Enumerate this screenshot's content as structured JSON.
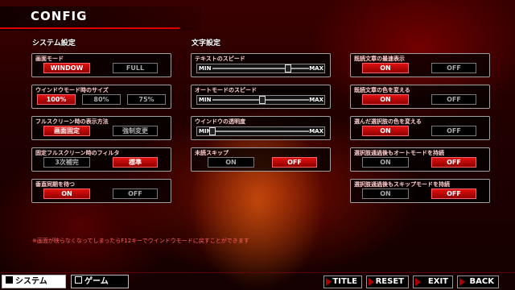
{
  "header": {
    "title": "CONFIG"
  },
  "sections": {
    "system": "システム設定",
    "text": "文字設定"
  },
  "system": {
    "screen_mode": {
      "label": "画面モード",
      "options": [
        "WINDOW",
        "FULL"
      ],
      "selected": "WINDOW"
    },
    "window_size": {
      "label": "ウインドウモード時のサイズ",
      "options": [
        "100%",
        "80%",
        "75%"
      ],
      "selected": "100%"
    },
    "fullscreen_display": {
      "label": "フルスクリーン時の表示方法",
      "options": [
        "画面固定",
        "強制変更"
      ],
      "selected": "画面固定"
    },
    "fixed_fullscreen_filter": {
      "label": "固定フルスクリーン時のフィルタ",
      "options": [
        "3次補完",
        "標準"
      ],
      "selected": "標準"
    },
    "vsync": {
      "label": "垂直同期を待つ",
      "options": [
        "ON",
        "OFF"
      ],
      "selected": "ON"
    }
  },
  "text": {
    "text_speed": {
      "label": "テキストのスピード",
      "min": "MIN",
      "max": "MAX",
      "level": 0.78
    },
    "auto_speed": {
      "label": "オートモードのスピード",
      "min": "MIN",
      "max": "MAX",
      "level": 0.52
    },
    "window_opacity": {
      "label": "ウインドウの透明度",
      "min": "MIN",
      "max": "MAX",
      "level": 0.0
    },
    "skip_unread": {
      "label": "未読スキップ",
      "options": [
        "ON",
        "OFF"
      ],
      "selected": "OFF"
    }
  },
  "read": {
    "fastest_read_text": {
      "label": "既読文章の最速表示",
      "options": [
        "ON",
        "OFF"
      ],
      "selected": "ON"
    },
    "read_text_color": {
      "label": "既読文章の色を変える",
      "options": [
        "ON",
        "OFF"
      ],
      "selected": "ON"
    },
    "chosen_choice_color": {
      "label": "選んだ選択肢の色を変える",
      "options": [
        "ON",
        "OFF"
      ],
      "selected": "ON"
    },
    "keep_auto_after_choice": {
      "label": "選択肢通過後もオートモードを持続",
      "options": [
        "ON",
        "OFF"
      ],
      "selected": "OFF"
    },
    "keep_skip_after_choice": {
      "label": "選択肢通過後もスキップモードを持続",
      "options": [
        "ON",
        "OFF"
      ],
      "selected": "OFF"
    }
  },
  "note": "※画面が映らなくなってしまったらF12キーでウインドウモードに戻すことができます",
  "tabs": [
    {
      "label": "システム",
      "active": true
    },
    {
      "label": "ゲーム",
      "active": false
    }
  ],
  "nav": {
    "title": "TITLE",
    "reset": "RESET",
    "exit": "EXIT",
    "back": "BACK"
  },
  "colors": {
    "accent": "#e00000",
    "selected_button": "#c00000"
  }
}
